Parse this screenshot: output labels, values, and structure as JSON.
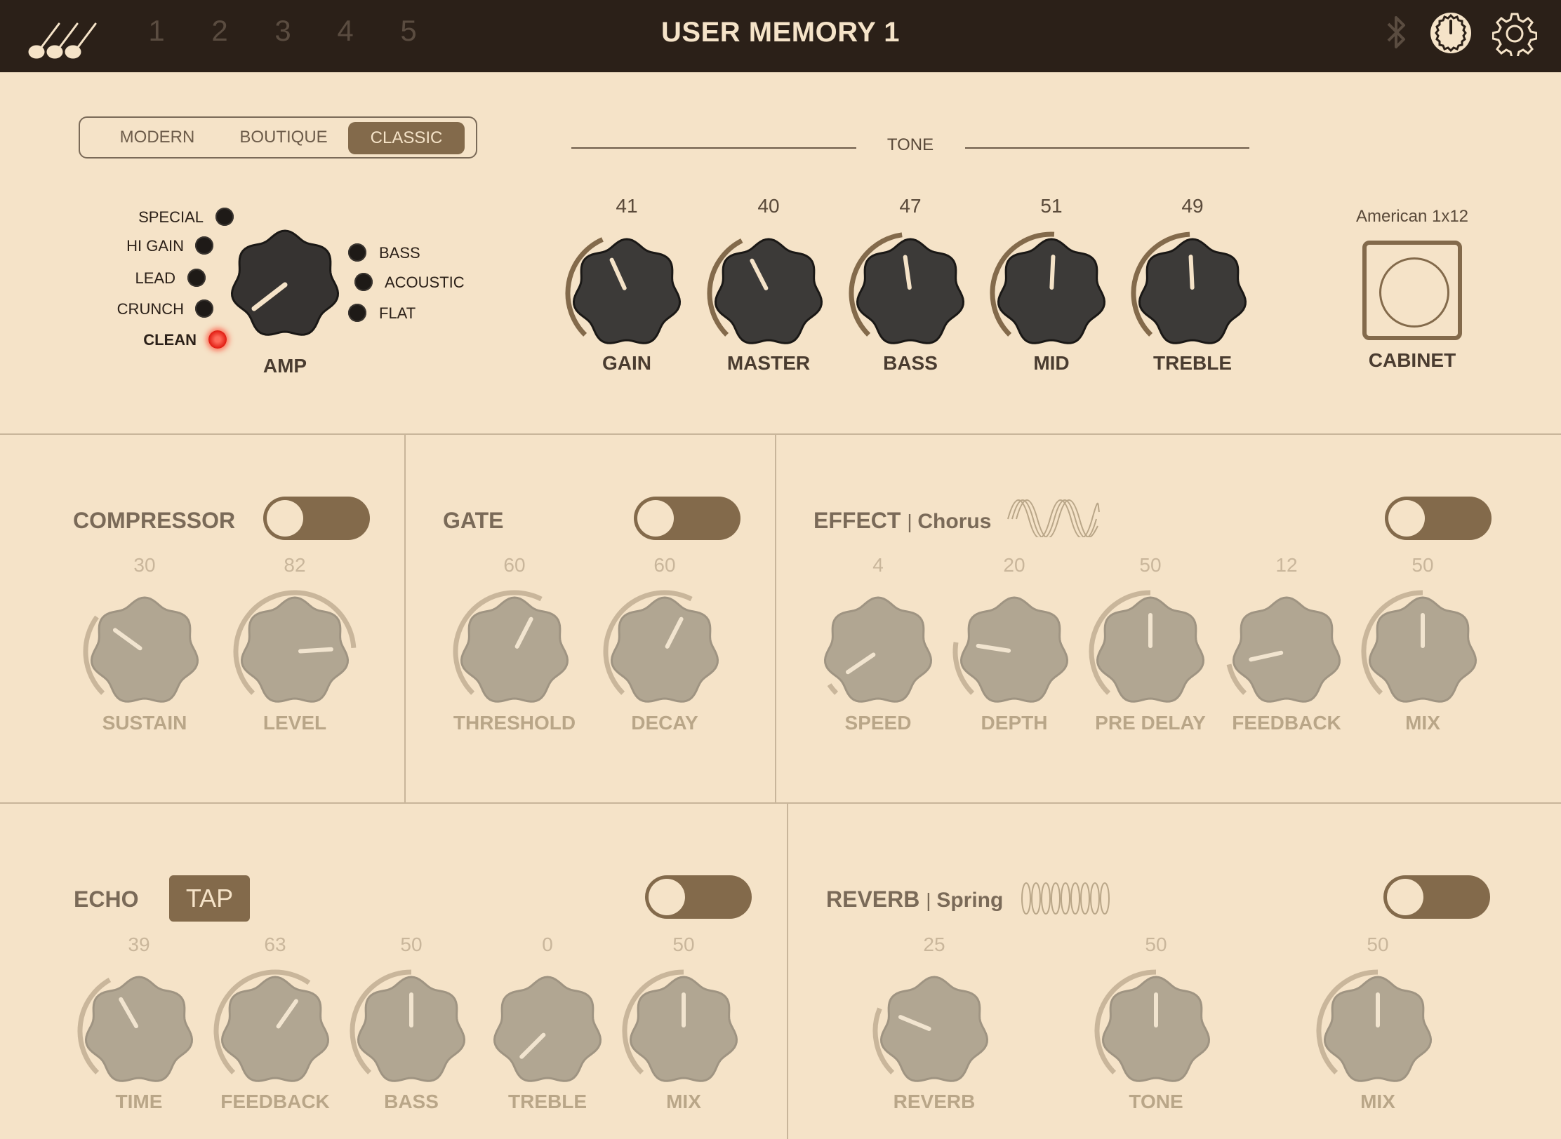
{
  "app": {
    "title": "USER MEMORY 1",
    "memory_slots": [
      "1",
      "2",
      "3",
      "4",
      "5"
    ],
    "icons": [
      "guitars-logo-icon",
      "bluetooth-icon",
      "tuner-icon",
      "gear-icon"
    ]
  },
  "amp": {
    "models": [
      "MODERN",
      "BOUTIQUE",
      "CLASSIC"
    ],
    "selected_model": "CLASSIC",
    "tone_header": "TONE",
    "channels_left": [
      "SPECIAL",
      "HI GAIN",
      "LEAD",
      "CRUNCH",
      "CLEAN"
    ],
    "channels_right": [
      "BASS",
      "ACOUSTIC",
      "FLAT"
    ],
    "active_channel": "CLEAN",
    "amp_label": "AMP",
    "knobs": [
      {
        "label": "GAIN",
        "value": "41"
      },
      {
        "label": "MASTER",
        "value": "40"
      },
      {
        "label": "BASS",
        "value": "47"
      },
      {
        "label": "MID",
        "value": "51"
      },
      {
        "label": "TREBLE",
        "value": "49"
      }
    ],
    "cabinet_name": "American 1x12",
    "cabinet_label": "CABINET"
  },
  "compressor": {
    "title": "COMPRESSOR",
    "enabled": false,
    "knobs": [
      {
        "label": "SUSTAIN",
        "value": "30"
      },
      {
        "label": "LEVEL",
        "value": "82"
      }
    ]
  },
  "gate": {
    "title": "GATE",
    "enabled": false,
    "knobs": [
      {
        "label": "THRESHOLD",
        "value": "60"
      },
      {
        "label": "DECAY",
        "value": "60"
      }
    ]
  },
  "effect": {
    "title": "EFFECT",
    "type": "Chorus",
    "enabled": false,
    "knobs": [
      {
        "label": "SPEED",
        "value": "4"
      },
      {
        "label": "DEPTH",
        "value": "20"
      },
      {
        "label": "PRE DELAY",
        "value": "50"
      },
      {
        "label": "FEEDBACK",
        "value": "12"
      },
      {
        "label": "MIX",
        "value": "50"
      }
    ]
  },
  "echo": {
    "title": "ECHO",
    "tap_label": "TAP",
    "enabled": false,
    "knobs": [
      {
        "label": "TIME",
        "value": "39"
      },
      {
        "label": "FEEDBACK",
        "value": "63"
      },
      {
        "label": "BASS",
        "value": "50"
      },
      {
        "label": "TREBLE",
        "value": "0"
      },
      {
        "label": "MIX",
        "value": "50"
      }
    ]
  },
  "reverb": {
    "title": "REVERB",
    "type": "Spring",
    "enabled": false,
    "knobs": [
      {
        "label": "REVERB",
        "value": "25"
      },
      {
        "label": "TONE",
        "value": "50"
      },
      {
        "label": "MIX",
        "value": "50"
      }
    ]
  },
  "colors": {
    "topbar": "#2b2018",
    "background": "#f5e3c8",
    "accent": "#836a4b",
    "dark_knob": "#3c3a38",
    "faded_knob": "#b1a692",
    "led_on": "#e01a10"
  }
}
